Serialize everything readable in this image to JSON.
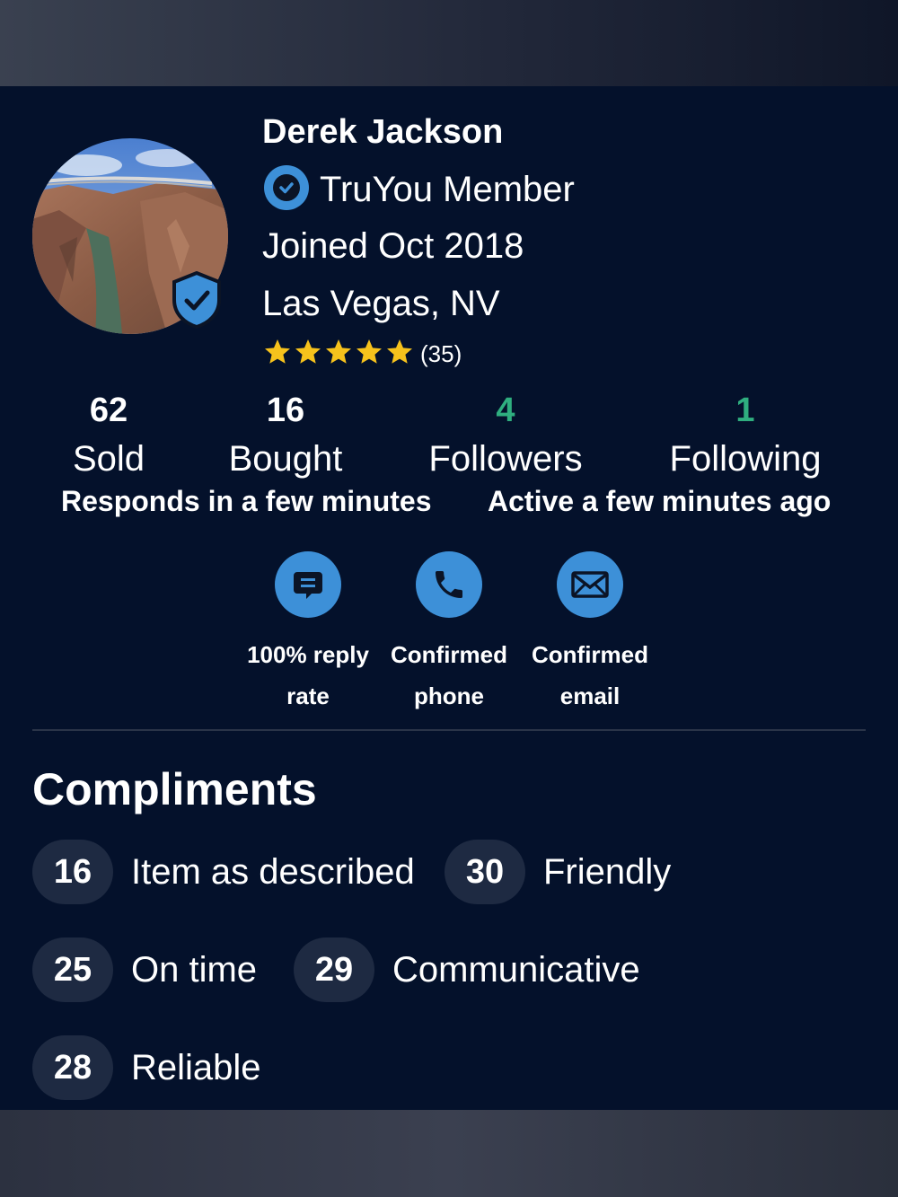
{
  "profile": {
    "name": "Derek Jackson",
    "membership": "TruYou Member",
    "joined": "Joined Oct 2018",
    "location": "Las Vegas, NV",
    "rating_stars": 5,
    "rating_count": "(35)"
  },
  "stats": [
    {
      "value": "62",
      "label": "Sold"
    },
    {
      "value": "16",
      "label": "Bought"
    },
    {
      "value": "4",
      "label": "Followers"
    },
    {
      "value": "1",
      "label": "Following"
    }
  ],
  "activity": {
    "response": "Responds in a few minutes",
    "active": "Active a few minutes ago"
  },
  "trust": [
    {
      "icon": "chat-icon",
      "line1": "100% reply",
      "line2": "rate"
    },
    {
      "icon": "phone-icon",
      "line1": "Confirmed",
      "line2": "phone"
    },
    {
      "icon": "envelope-icon",
      "line1": "Confirmed",
      "line2": "email"
    }
  ],
  "compliments": {
    "title": "Compliments",
    "items": [
      {
        "count": "16",
        "label": "Item as described"
      },
      {
        "count": "30",
        "label": "Friendly"
      },
      {
        "count": "25",
        "label": "On time"
      },
      {
        "count": "29",
        "label": "Communicative"
      },
      {
        "count": "28",
        "label": "Reliable"
      }
    ]
  },
  "colors": {
    "background": "#04112b",
    "accent_blue": "#3d90d8",
    "green": "#2fae7f",
    "star": "#f6c21c",
    "chip": "#1e2a42"
  }
}
